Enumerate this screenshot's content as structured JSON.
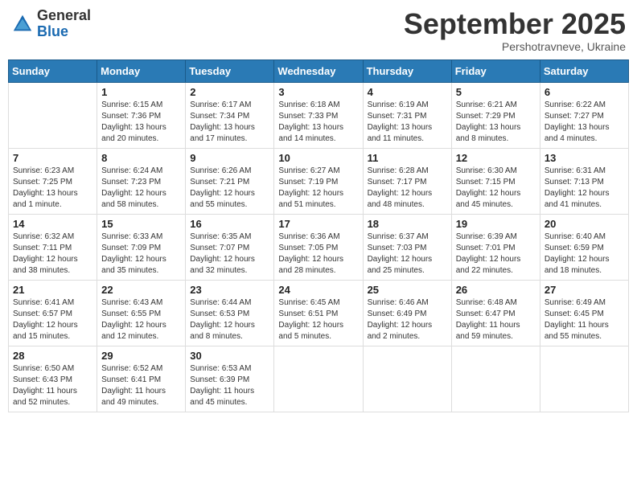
{
  "header": {
    "logo_general": "General",
    "logo_blue": "Blue",
    "month_title": "September 2025",
    "location": "Pershotravneve, Ukraine"
  },
  "days_of_week": [
    "Sunday",
    "Monday",
    "Tuesday",
    "Wednesday",
    "Thursday",
    "Friday",
    "Saturday"
  ],
  "weeks": [
    [
      {
        "day": "",
        "info": ""
      },
      {
        "day": "1",
        "info": "Sunrise: 6:15 AM\nSunset: 7:36 PM\nDaylight: 13 hours\nand 20 minutes."
      },
      {
        "day": "2",
        "info": "Sunrise: 6:17 AM\nSunset: 7:34 PM\nDaylight: 13 hours\nand 17 minutes."
      },
      {
        "day": "3",
        "info": "Sunrise: 6:18 AM\nSunset: 7:33 PM\nDaylight: 13 hours\nand 14 minutes."
      },
      {
        "day": "4",
        "info": "Sunrise: 6:19 AM\nSunset: 7:31 PM\nDaylight: 13 hours\nand 11 minutes."
      },
      {
        "day": "5",
        "info": "Sunrise: 6:21 AM\nSunset: 7:29 PM\nDaylight: 13 hours\nand 8 minutes."
      },
      {
        "day": "6",
        "info": "Sunrise: 6:22 AM\nSunset: 7:27 PM\nDaylight: 13 hours\nand 4 minutes."
      }
    ],
    [
      {
        "day": "7",
        "info": "Sunrise: 6:23 AM\nSunset: 7:25 PM\nDaylight: 13 hours\nand 1 minute."
      },
      {
        "day": "8",
        "info": "Sunrise: 6:24 AM\nSunset: 7:23 PM\nDaylight: 12 hours\nand 58 minutes."
      },
      {
        "day": "9",
        "info": "Sunrise: 6:26 AM\nSunset: 7:21 PM\nDaylight: 12 hours\nand 55 minutes."
      },
      {
        "day": "10",
        "info": "Sunrise: 6:27 AM\nSunset: 7:19 PM\nDaylight: 12 hours\nand 51 minutes."
      },
      {
        "day": "11",
        "info": "Sunrise: 6:28 AM\nSunset: 7:17 PM\nDaylight: 12 hours\nand 48 minutes."
      },
      {
        "day": "12",
        "info": "Sunrise: 6:30 AM\nSunset: 7:15 PM\nDaylight: 12 hours\nand 45 minutes."
      },
      {
        "day": "13",
        "info": "Sunrise: 6:31 AM\nSunset: 7:13 PM\nDaylight: 12 hours\nand 41 minutes."
      }
    ],
    [
      {
        "day": "14",
        "info": "Sunrise: 6:32 AM\nSunset: 7:11 PM\nDaylight: 12 hours\nand 38 minutes."
      },
      {
        "day": "15",
        "info": "Sunrise: 6:33 AM\nSunset: 7:09 PM\nDaylight: 12 hours\nand 35 minutes."
      },
      {
        "day": "16",
        "info": "Sunrise: 6:35 AM\nSunset: 7:07 PM\nDaylight: 12 hours\nand 32 minutes."
      },
      {
        "day": "17",
        "info": "Sunrise: 6:36 AM\nSunset: 7:05 PM\nDaylight: 12 hours\nand 28 minutes."
      },
      {
        "day": "18",
        "info": "Sunrise: 6:37 AM\nSunset: 7:03 PM\nDaylight: 12 hours\nand 25 minutes."
      },
      {
        "day": "19",
        "info": "Sunrise: 6:39 AM\nSunset: 7:01 PM\nDaylight: 12 hours\nand 22 minutes."
      },
      {
        "day": "20",
        "info": "Sunrise: 6:40 AM\nSunset: 6:59 PM\nDaylight: 12 hours\nand 18 minutes."
      }
    ],
    [
      {
        "day": "21",
        "info": "Sunrise: 6:41 AM\nSunset: 6:57 PM\nDaylight: 12 hours\nand 15 minutes."
      },
      {
        "day": "22",
        "info": "Sunrise: 6:43 AM\nSunset: 6:55 PM\nDaylight: 12 hours\nand 12 minutes."
      },
      {
        "day": "23",
        "info": "Sunrise: 6:44 AM\nSunset: 6:53 PM\nDaylight: 12 hours\nand 8 minutes."
      },
      {
        "day": "24",
        "info": "Sunrise: 6:45 AM\nSunset: 6:51 PM\nDaylight: 12 hours\nand 5 minutes."
      },
      {
        "day": "25",
        "info": "Sunrise: 6:46 AM\nSunset: 6:49 PM\nDaylight: 12 hours\nand 2 minutes."
      },
      {
        "day": "26",
        "info": "Sunrise: 6:48 AM\nSunset: 6:47 PM\nDaylight: 11 hours\nand 59 minutes."
      },
      {
        "day": "27",
        "info": "Sunrise: 6:49 AM\nSunset: 6:45 PM\nDaylight: 11 hours\nand 55 minutes."
      }
    ],
    [
      {
        "day": "28",
        "info": "Sunrise: 6:50 AM\nSunset: 6:43 PM\nDaylight: 11 hours\nand 52 minutes."
      },
      {
        "day": "29",
        "info": "Sunrise: 6:52 AM\nSunset: 6:41 PM\nDaylight: 11 hours\nand 49 minutes."
      },
      {
        "day": "30",
        "info": "Sunrise: 6:53 AM\nSunset: 6:39 PM\nDaylight: 11 hours\nand 45 minutes."
      },
      {
        "day": "",
        "info": ""
      },
      {
        "day": "",
        "info": ""
      },
      {
        "day": "",
        "info": ""
      },
      {
        "day": "",
        "info": ""
      }
    ]
  ]
}
